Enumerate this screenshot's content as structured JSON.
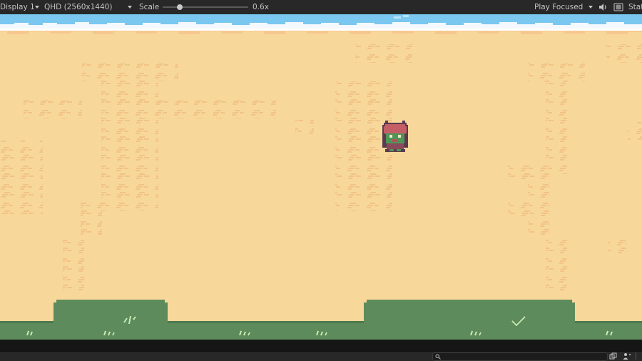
{
  "toolbar": {
    "display_label": "Display 1",
    "resolution_label": "QHD (2560x1440)",
    "scale_label": "Scale",
    "scale_value": "0.6x",
    "scale_fraction": 0.2,
    "play_mode_label": "Play Focused",
    "stats_label": "Stats"
  },
  "icons": {
    "audio": "speaker-icon",
    "keyboard": "keyboard-icon",
    "search": "search-icon",
    "layers": "layers-icon",
    "account": "account-icon"
  },
  "colors": {
    "sand": "#f8d79a",
    "sand_mark": "#f1c386",
    "water": "#7ac8f0",
    "foam": "#f4f9ff",
    "shore": "#f6c88e",
    "grass": "#5e8b5b",
    "grass_light": "#c8e8b0",
    "toolbar": "#282828"
  }
}
